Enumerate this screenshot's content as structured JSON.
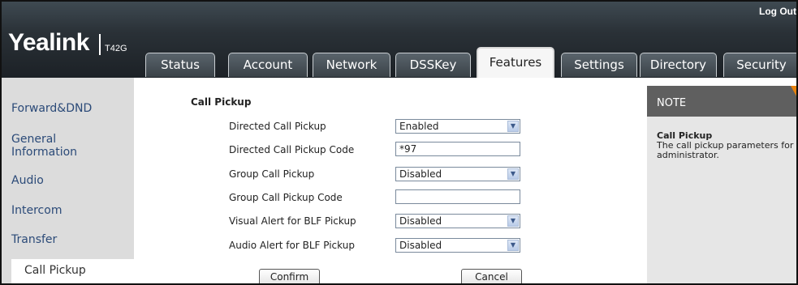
{
  "header": {
    "logo": "Yealink",
    "model": "T42G",
    "logout": "Log Out"
  },
  "tabs": [
    {
      "label": "Status"
    },
    {
      "label": "Account"
    },
    {
      "label": "Network"
    },
    {
      "label": "DSSKey"
    },
    {
      "label": "Features"
    },
    {
      "label": "Settings"
    },
    {
      "label": "Directory"
    },
    {
      "label": "Security"
    }
  ],
  "active_tab": "Features",
  "sidebar": {
    "items": [
      {
        "label": "Forward&DND"
      },
      {
        "label": "General\nInformation"
      },
      {
        "label": "Audio"
      },
      {
        "label": "Intercom"
      },
      {
        "label": "Transfer"
      },
      {
        "label": "Call Pickup"
      }
    ],
    "active": "Call Pickup"
  },
  "form": {
    "section_title": "Call Pickup",
    "fields": [
      {
        "label": "Directed Call Pickup",
        "type": "select",
        "value": "Enabled"
      },
      {
        "label": "Directed Call Pickup Code",
        "type": "text",
        "value": "*97"
      },
      {
        "label": "Group Call Pickup",
        "type": "select",
        "value": "Disabled"
      },
      {
        "label": "Group Call Pickup Code",
        "type": "text",
        "value": ""
      },
      {
        "label": "Visual Alert for BLF Pickup",
        "type": "select",
        "value": "Disabled"
      },
      {
        "label": "Audio Alert for BLF Pickup",
        "type": "select",
        "value": "Disabled"
      }
    ],
    "confirm_label": "Confirm",
    "cancel_label": "Cancel"
  },
  "note": {
    "title": "NOTE",
    "subtitle": "Call Pickup",
    "text": "The call pickup parameters for administrator."
  },
  "colors": {
    "header_bg": "#2a3137",
    "sidebar_bg": "#dcdcdc",
    "link": "#2b4a78",
    "note_head": "#5f5f5f",
    "accent": "#e8820e"
  },
  "icons": {
    "dropdown": "chevron-down-icon"
  }
}
